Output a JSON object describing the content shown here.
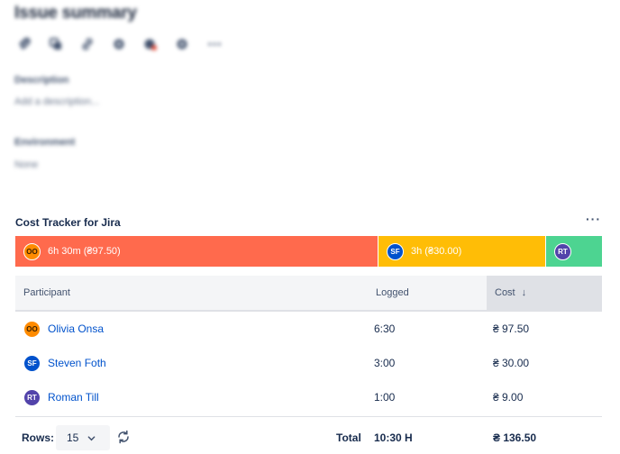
{
  "issue": {
    "title": "Issue summary",
    "toolbar": [
      {
        "name": "attach-icon"
      },
      {
        "name": "subtask-icon"
      },
      {
        "name": "link-icon"
      },
      {
        "name": "gear-icon"
      },
      {
        "name": "alert-icon"
      },
      {
        "name": "settings-icon"
      },
      {
        "name": "more-icon"
      }
    ],
    "description_label": "Description",
    "description_placeholder": "Add a description...",
    "environment_label": "Environment",
    "environment_value": "None"
  },
  "cost_tracker": {
    "title": "Cost Tracker for Jira",
    "more_label": "···",
    "bar": [
      {
        "initials": "OO",
        "label": "6h 30m (₴97.50)",
        "color": "#ff6a4d"
      },
      {
        "initials": "SF",
        "label": "3h (₴30.00)",
        "color": "#ffbd06"
      },
      {
        "initials": "RT",
        "label": "",
        "color": "#4dd491"
      }
    ],
    "columns": {
      "participant": "Participant",
      "logged": "Logged",
      "cost": "Cost",
      "sort_icon": "arrow-down-icon"
    },
    "rows": [
      {
        "initials": "OO",
        "name": "Olivia Onsa",
        "logged": "6:30",
        "cost": "₴ 97.50"
      },
      {
        "initials": "SF",
        "name": "Steven Foth",
        "logged": "3:00",
        "cost": "₴ 30.00"
      },
      {
        "initials": "RT",
        "name": "Roman Till",
        "logged": "1:00",
        "cost": "₴ 9.00"
      }
    ],
    "footer": {
      "rows_label": "Rows:",
      "rows_value": "15",
      "total_label": "Total",
      "total_logged": "10:30 H",
      "total_cost": "₴ 136.50"
    }
  }
}
